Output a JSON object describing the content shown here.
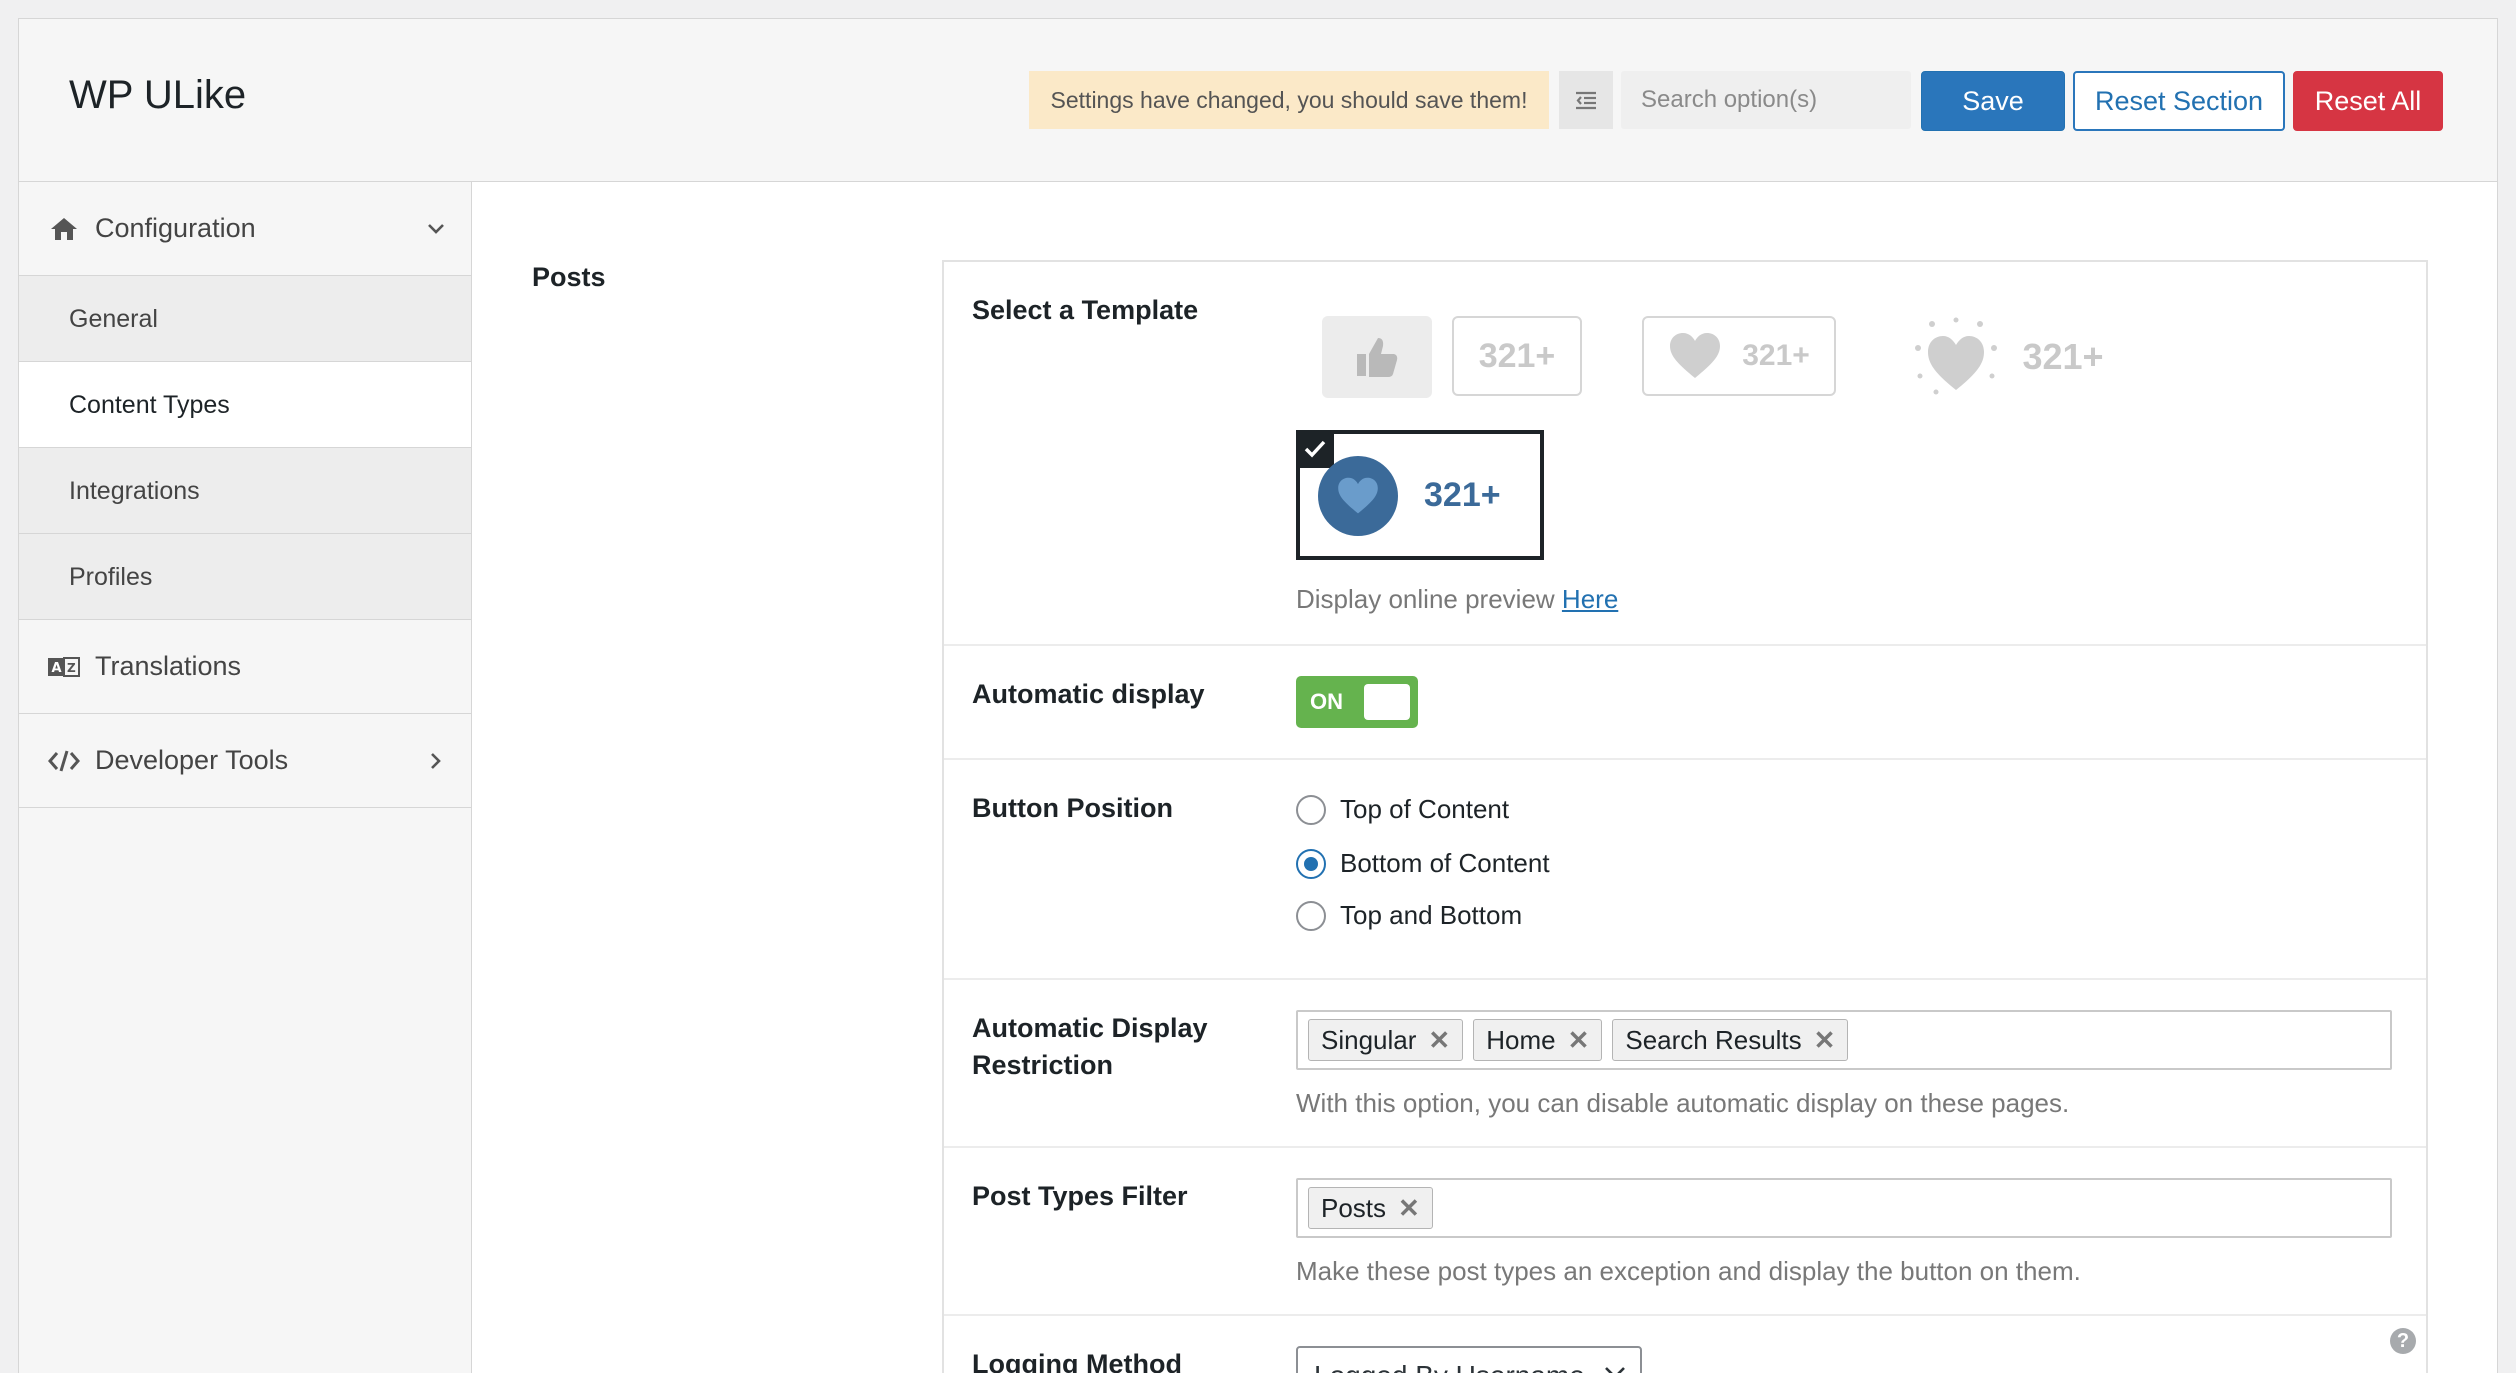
{
  "header": {
    "app_title": "WP ULike",
    "notice": "Settings have changed, you should save them!",
    "search_placeholder": "Search option(s)",
    "save_label": "Save",
    "reset_section_label": "Reset Section",
    "reset_all_label": "Reset All"
  },
  "sidebar": {
    "configuration": "Configuration",
    "items": [
      "General",
      "Content Types",
      "Integrations",
      "Profiles"
    ],
    "active_item": "Content Types",
    "translations": "Translations",
    "developer_tools": "Developer Tools"
  },
  "main": {
    "section_title": "Posts",
    "template": {
      "label": "Select a Template",
      "counter": "321+",
      "selected_template": 4,
      "preview_text": "Display online preview",
      "preview_link": "Here"
    },
    "automatic_display": {
      "label": "Automatic display",
      "toggle_text": "ON",
      "enabled": true
    },
    "button_position": {
      "label": "Button Position",
      "options": [
        "Top of Content",
        "Bottom of Content",
        "Top and Bottom"
      ],
      "selected": "Bottom of Content"
    },
    "restriction": {
      "label_line1": "Automatic Display",
      "label_line2": "Restriction",
      "tags": [
        "Singular",
        "Home",
        "Search Results"
      ],
      "tag_remove": "✕",
      "description": "With this option, you can disable automatic display on these pages."
    },
    "post_types": {
      "label": "Post Types Filter",
      "tags": [
        "Posts"
      ],
      "description": "Make these post types an exception and display the button on them."
    },
    "logging": {
      "label": "Logging Method",
      "value": "Logged By Username"
    }
  },
  "colors": {
    "primary": "#2271b1",
    "danger": "#d63543",
    "toggle_on": "#65b34e",
    "notice_bg": "#fbe9c8",
    "template_blue": "#3b6a99"
  }
}
